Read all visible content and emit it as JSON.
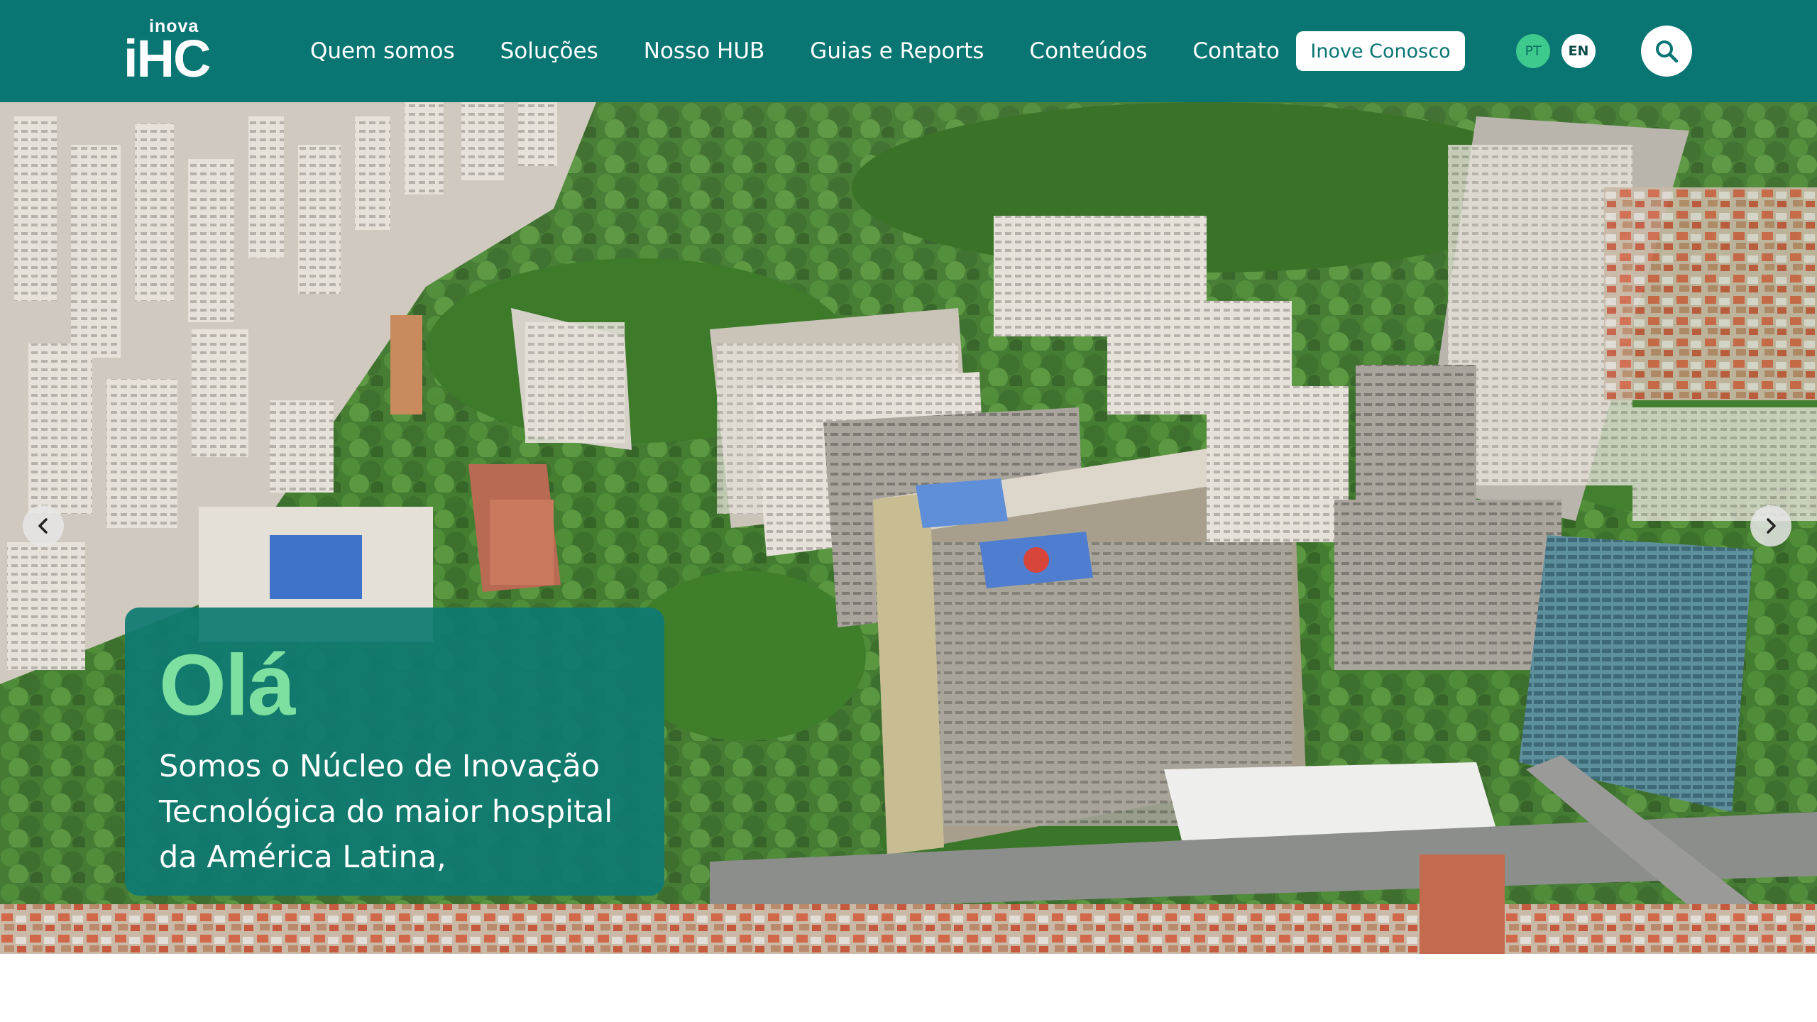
{
  "header": {
    "logo": {
      "small": "inova",
      "big": "iHC"
    },
    "nav": [
      {
        "label": "Quem somos"
      },
      {
        "label": "Soluções"
      },
      {
        "label": "Nosso HUB"
      },
      {
        "label": "Guias e Reports"
      },
      {
        "label": "Conteúdos"
      },
      {
        "label": "Contato"
      }
    ],
    "cta_label": "Inove Conosco",
    "languages": {
      "pt": "PT",
      "en": "EN"
    },
    "search_icon": "search-icon"
  },
  "hero": {
    "title": "Olá",
    "text": "Somos o Núcleo de Inovação Tecnológica do maior hospital da América Latina,",
    "prev_icon": "chevron-left-icon",
    "next_icon": "chevron-right-icon",
    "image": "aerial-city-hospital-photo"
  },
  "colors": {
    "header_bg": "#097673",
    "accent_green": "#7de0a0",
    "card_bg": "#0e7a72",
    "active_lang": "#3ec98d"
  }
}
